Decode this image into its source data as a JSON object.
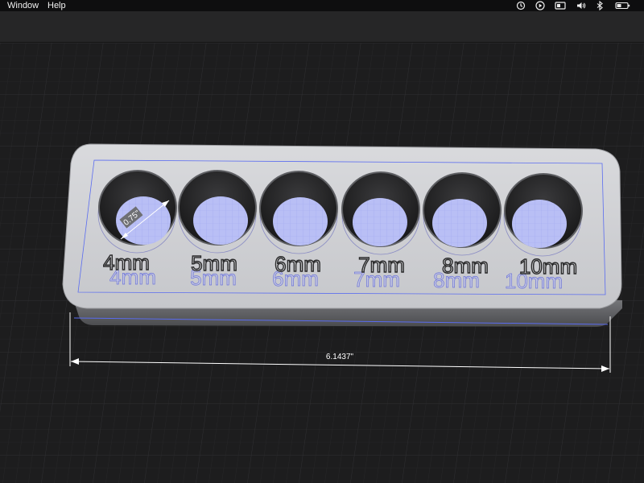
{
  "menubar": {
    "items": [
      "Window",
      "Help"
    ],
    "status_icons": [
      "history-icon",
      "play-icon",
      "display-icon",
      "volume-icon",
      "bluetooth-icon",
      "battery-icon"
    ]
  },
  "model": {
    "labels": [
      "4mm",
      "5mm",
      "6mm",
      "7mm",
      "8mm",
      "10mm"
    ],
    "hole_diameter_dimension": "0.75\"",
    "overall_length_dimension": "6.1437\""
  },
  "colors": {
    "background": "#1d1d1e",
    "model_body": "#cfd0d4",
    "sketch_lines": "#5a6cf0",
    "sketch_fill": "#b9bff5",
    "dimension_text": "#ffffff"
  }
}
